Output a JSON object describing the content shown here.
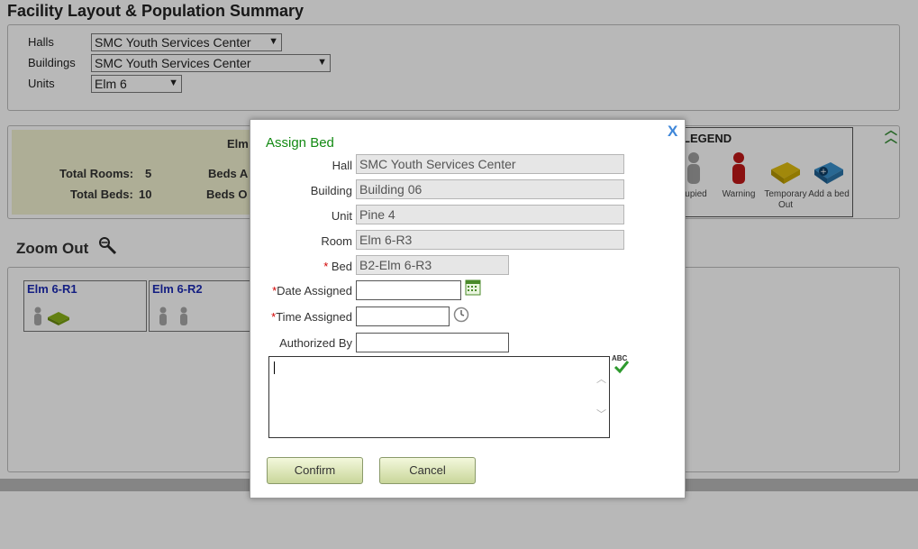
{
  "page": {
    "title": "Facility Layout & Population Summary"
  },
  "filters": {
    "halls_label": "Halls",
    "halls_value": "SMC Youth Services Center",
    "buildings_label": "Buildings",
    "buildings_value": "SMC Youth Services Center",
    "units_label": "Units",
    "units_value": "Elm 6"
  },
  "summary": {
    "unit_name": "Elm",
    "total_rooms_label": "Total Rooms:",
    "total_rooms_value": "5",
    "total_beds_label": "Total Beds:",
    "total_beds_value": "10",
    "beds_a_label": "Beds A",
    "beds_o_label": "Beds O"
  },
  "legend": {
    "title": "LEGEND",
    "items": [
      {
        "label": "cupied",
        "icon": "person-grey-icon",
        "color": "#a0a0a0"
      },
      {
        "label": "Warning",
        "icon": "person-red-icon",
        "color": "#c01818"
      },
      {
        "label": "Temporary Out",
        "icon": "bed-yellow-icon",
        "color": "#d4b000"
      },
      {
        "label": "Add a bed",
        "icon": "bed-add-icon",
        "color": "#2a7ab8"
      }
    ]
  },
  "zoom": {
    "label": "Zoom Out"
  },
  "rooms": [
    {
      "name": "Elm 6-R1"
    },
    {
      "name": "Elm 6-R2"
    }
  ],
  "modal": {
    "title": "Assign Bed",
    "close": "X",
    "hall_label": "Hall",
    "hall_value": "SMC Youth Services Center",
    "building_label": "Building",
    "building_value": "Building 06",
    "unit_label": "Unit",
    "unit_value": "Pine 4",
    "room_label": "Room",
    "room_value": "Elm 6-R3",
    "bed_label": "Bed",
    "bed_value": "B2-Elm 6-R3",
    "date_label": "Date Assigned",
    "date_value": "",
    "time_label": "Time Assigned",
    "time_value": "",
    "authorized_label": "Authorized By",
    "authorized_value": "",
    "notes_value": "",
    "spell_check": "ABC",
    "confirm": "Confirm",
    "cancel": "Cancel"
  },
  "colors": {
    "accent_green": "#138a13",
    "required_red": "#d10000",
    "close_blue": "#3f87d9"
  }
}
